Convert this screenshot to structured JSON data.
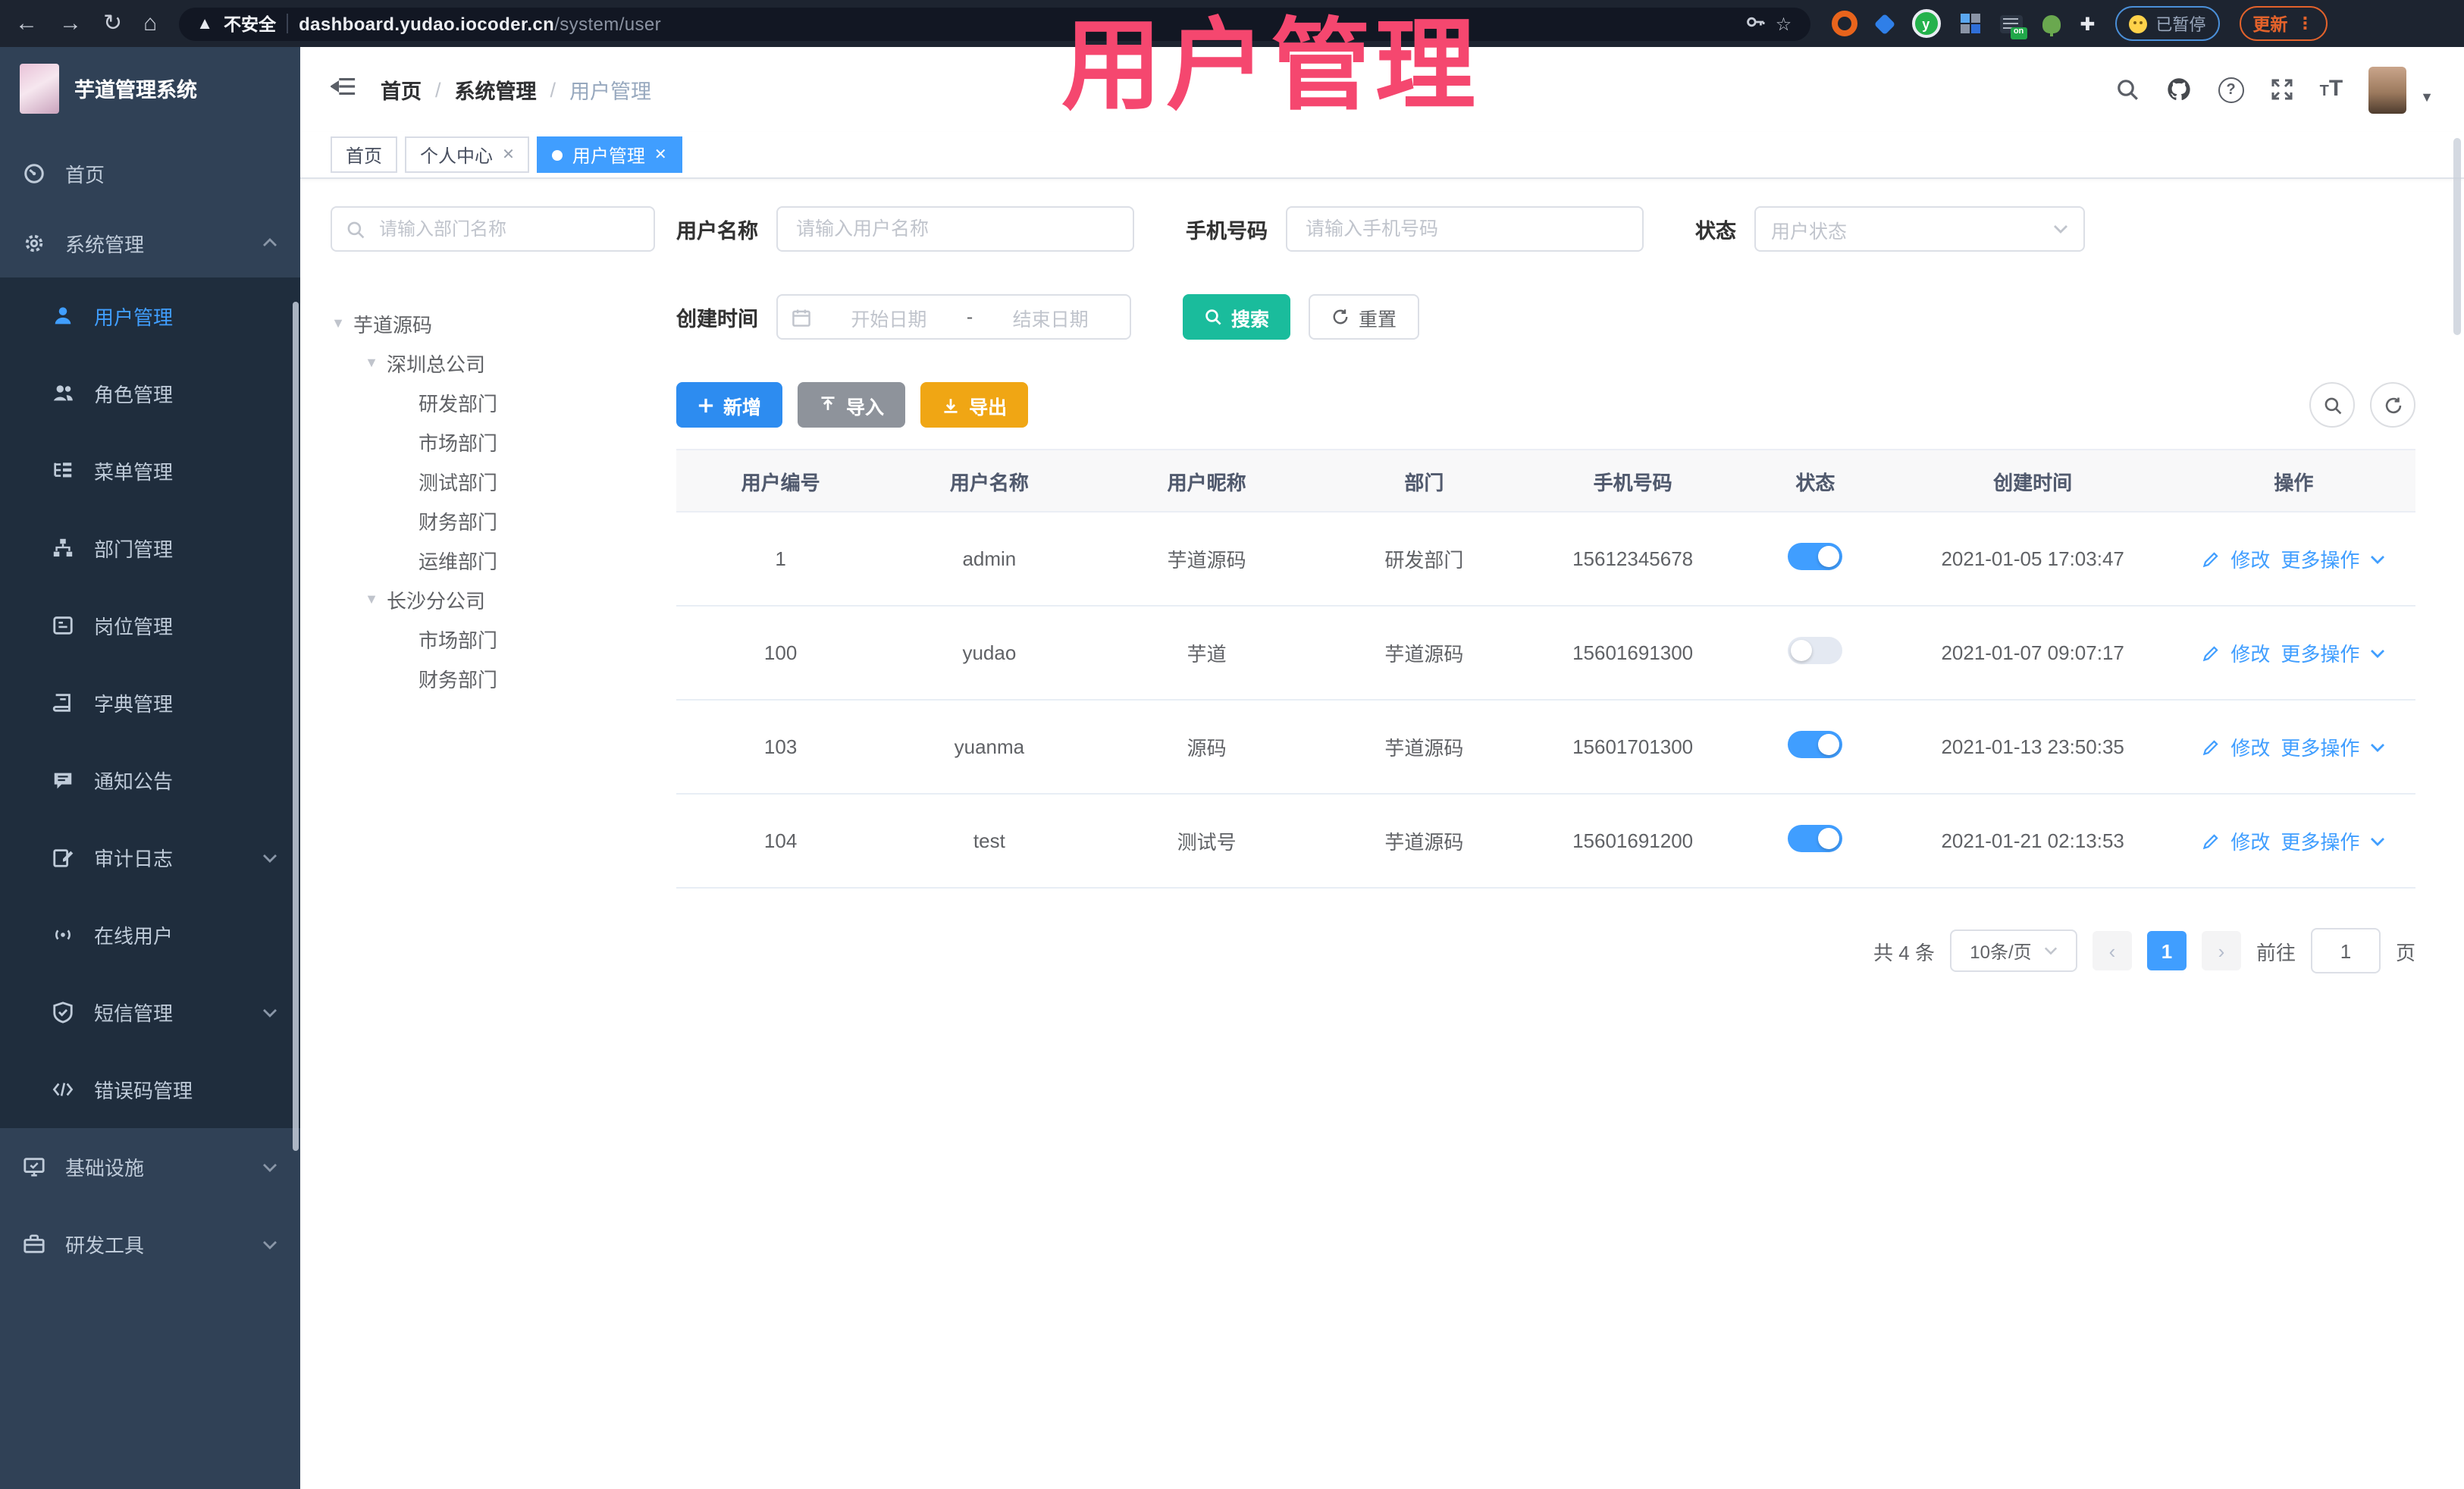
{
  "browser": {
    "security_label": "不安全",
    "url_host": "dashboard.yudao.iocoder.cn",
    "url_path": "/system/user",
    "profile_badge": "已暂停",
    "update_label": "更新"
  },
  "overlay": {
    "title": "用户管理"
  },
  "app": {
    "logo_title": "芋道管理系统"
  },
  "breadcrumb": {
    "items": [
      "首页",
      "系统管理",
      "用户管理"
    ]
  },
  "tabs": [
    {
      "label": "首页"
    },
    {
      "label": "个人中心"
    },
    {
      "label": "用户管理"
    }
  ],
  "sidebar": {
    "home": "首页",
    "system": "系统管理",
    "system_children": [
      "用户管理",
      "角色管理",
      "菜单管理",
      "部门管理",
      "岗位管理",
      "字典管理",
      "通知公告",
      "审计日志",
      "在线用户",
      "短信管理",
      "错误码管理"
    ],
    "infra": "基础设施",
    "devtools": "研发工具"
  },
  "tree": {
    "search_placeholder": "请输入部门名称",
    "nodes": [
      "芋道源码",
      "深圳总公司",
      "研发部门",
      "市场部门",
      "测试部门",
      "财务部门",
      "运维部门",
      "长沙分公司",
      "市场部门",
      "财务部门"
    ]
  },
  "filters": {
    "username_label": "用户名称",
    "username_placeholder": "请输入用户名称",
    "mobile_label": "手机号码",
    "mobile_placeholder": "请输入手机号码",
    "status_label": "状态",
    "status_placeholder": "用户状态",
    "created_label": "创建时间",
    "date_start_placeholder": "开始日期",
    "date_separator": "-",
    "date_end_placeholder": "结束日期",
    "search_label": "搜索",
    "reset_label": "重置"
  },
  "toolbar": {
    "add": "新增",
    "import": "导入",
    "export": "导出"
  },
  "table": {
    "columns": [
      "用户编号",
      "用户名称",
      "用户昵称",
      "部门",
      "手机号码",
      "状态",
      "创建时间",
      "操作"
    ],
    "edit_label": "修改",
    "more_label": "更多操作",
    "rows": [
      {
        "id": "1",
        "username": "admin",
        "nickname": "芋道源码",
        "dept": "研发部门",
        "mobile": "15612345678",
        "status": true,
        "created": "2021-01-05 17:03:47"
      },
      {
        "id": "100",
        "username": "yudao",
        "nickname": "芋道",
        "dept": "芋道源码",
        "mobile": "15601691300",
        "status": false,
        "created": "2021-01-07 09:07:17"
      },
      {
        "id": "103",
        "username": "yuanma",
        "nickname": "源码",
        "dept": "芋道源码",
        "mobile": "15601701300",
        "status": true,
        "created": "2021-01-13 23:50:35"
      },
      {
        "id": "104",
        "username": "test",
        "nickname": "测试号",
        "dept": "芋道源码",
        "mobile": "15601691200",
        "status": true,
        "created": "2021-01-21 02:13:53"
      }
    ]
  },
  "pagination": {
    "total": "共 4 条",
    "page_size": "10条/页",
    "page": "1",
    "goto_label": "前往",
    "page_unit": "页"
  },
  "colors": {
    "accent": "#409eff",
    "teal": "#1abc9c",
    "amber": "#f0a614",
    "pink": "#f5476f"
  }
}
